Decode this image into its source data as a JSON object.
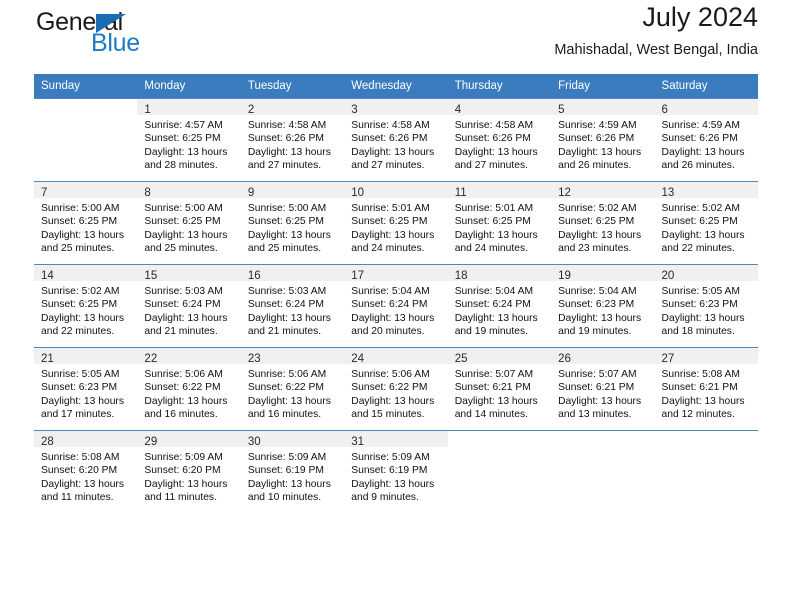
{
  "brand": {
    "name_top": "General",
    "name_bottom": "Blue",
    "triangle_color": "#1b6cb3",
    "blue_color": "#1f7ac4"
  },
  "header": {
    "title": "July 2024",
    "subtitle": "Mahishadal, West Bengal, India"
  },
  "theme": {
    "header_row_bg": "#3a7cbe",
    "header_row_text": "#ffffff",
    "daynum_bg": "#f0f0f0",
    "grid_line": "#4d88c4"
  },
  "weekday_headers": [
    "Sunday",
    "Monday",
    "Tuesday",
    "Wednesday",
    "Thursday",
    "Friday",
    "Saturday"
  ],
  "weeks": [
    [
      {
        "day": "",
        "lines": []
      },
      {
        "day": "1",
        "lines": [
          "Sunrise: 4:57 AM",
          "Sunset: 6:25 PM",
          "Daylight: 13 hours",
          "and 28 minutes."
        ]
      },
      {
        "day": "2",
        "lines": [
          "Sunrise: 4:58 AM",
          "Sunset: 6:26 PM",
          "Daylight: 13 hours",
          "and 27 minutes."
        ]
      },
      {
        "day": "3",
        "lines": [
          "Sunrise: 4:58 AM",
          "Sunset: 6:26 PM",
          "Daylight: 13 hours",
          "and 27 minutes."
        ]
      },
      {
        "day": "4",
        "lines": [
          "Sunrise: 4:58 AM",
          "Sunset: 6:26 PM",
          "Daylight: 13 hours",
          "and 27 minutes."
        ]
      },
      {
        "day": "5",
        "lines": [
          "Sunrise: 4:59 AM",
          "Sunset: 6:26 PM",
          "Daylight: 13 hours",
          "and 26 minutes."
        ]
      },
      {
        "day": "6",
        "lines": [
          "Sunrise: 4:59 AM",
          "Sunset: 6:26 PM",
          "Daylight: 13 hours",
          "and 26 minutes."
        ]
      }
    ],
    [
      {
        "day": "7",
        "lines": [
          "Sunrise: 5:00 AM",
          "Sunset: 6:25 PM",
          "Daylight: 13 hours",
          "and 25 minutes."
        ]
      },
      {
        "day": "8",
        "lines": [
          "Sunrise: 5:00 AM",
          "Sunset: 6:25 PM",
          "Daylight: 13 hours",
          "and 25 minutes."
        ]
      },
      {
        "day": "9",
        "lines": [
          "Sunrise: 5:00 AM",
          "Sunset: 6:25 PM",
          "Daylight: 13 hours",
          "and 25 minutes."
        ]
      },
      {
        "day": "10",
        "lines": [
          "Sunrise: 5:01 AM",
          "Sunset: 6:25 PM",
          "Daylight: 13 hours",
          "and 24 minutes."
        ]
      },
      {
        "day": "11",
        "lines": [
          "Sunrise: 5:01 AM",
          "Sunset: 6:25 PM",
          "Daylight: 13 hours",
          "and 24 minutes."
        ]
      },
      {
        "day": "12",
        "lines": [
          "Sunrise: 5:02 AM",
          "Sunset: 6:25 PM",
          "Daylight: 13 hours",
          "and 23 minutes."
        ]
      },
      {
        "day": "13",
        "lines": [
          "Sunrise: 5:02 AM",
          "Sunset: 6:25 PM",
          "Daylight: 13 hours",
          "and 22 minutes."
        ]
      }
    ],
    [
      {
        "day": "14",
        "lines": [
          "Sunrise: 5:02 AM",
          "Sunset: 6:25 PM",
          "Daylight: 13 hours",
          "and 22 minutes."
        ]
      },
      {
        "day": "15",
        "lines": [
          "Sunrise: 5:03 AM",
          "Sunset: 6:24 PM",
          "Daylight: 13 hours",
          "and 21 minutes."
        ]
      },
      {
        "day": "16",
        "lines": [
          "Sunrise: 5:03 AM",
          "Sunset: 6:24 PM",
          "Daylight: 13 hours",
          "and 21 minutes."
        ]
      },
      {
        "day": "17",
        "lines": [
          "Sunrise: 5:04 AM",
          "Sunset: 6:24 PM",
          "Daylight: 13 hours",
          "and 20 minutes."
        ]
      },
      {
        "day": "18",
        "lines": [
          "Sunrise: 5:04 AM",
          "Sunset: 6:24 PM",
          "Daylight: 13 hours",
          "and 19 minutes."
        ]
      },
      {
        "day": "19",
        "lines": [
          "Sunrise: 5:04 AM",
          "Sunset: 6:23 PM",
          "Daylight: 13 hours",
          "and 19 minutes."
        ]
      },
      {
        "day": "20",
        "lines": [
          "Sunrise: 5:05 AM",
          "Sunset: 6:23 PM",
          "Daylight: 13 hours",
          "and 18 minutes."
        ]
      }
    ],
    [
      {
        "day": "21",
        "lines": [
          "Sunrise: 5:05 AM",
          "Sunset: 6:23 PM",
          "Daylight: 13 hours",
          "and 17 minutes."
        ]
      },
      {
        "day": "22",
        "lines": [
          "Sunrise: 5:06 AM",
          "Sunset: 6:22 PM",
          "Daylight: 13 hours",
          "and 16 minutes."
        ]
      },
      {
        "day": "23",
        "lines": [
          "Sunrise: 5:06 AM",
          "Sunset: 6:22 PM",
          "Daylight: 13 hours",
          "and 16 minutes."
        ]
      },
      {
        "day": "24",
        "lines": [
          "Sunrise: 5:06 AM",
          "Sunset: 6:22 PM",
          "Daylight: 13 hours",
          "and 15 minutes."
        ]
      },
      {
        "day": "25",
        "lines": [
          "Sunrise: 5:07 AM",
          "Sunset: 6:21 PM",
          "Daylight: 13 hours",
          "and 14 minutes."
        ]
      },
      {
        "day": "26",
        "lines": [
          "Sunrise: 5:07 AM",
          "Sunset: 6:21 PM",
          "Daylight: 13 hours",
          "and 13 minutes."
        ]
      },
      {
        "day": "27",
        "lines": [
          "Sunrise: 5:08 AM",
          "Sunset: 6:21 PM",
          "Daylight: 13 hours",
          "and 12 minutes."
        ]
      }
    ],
    [
      {
        "day": "28",
        "lines": [
          "Sunrise: 5:08 AM",
          "Sunset: 6:20 PM",
          "Daylight: 13 hours",
          "and 11 minutes."
        ]
      },
      {
        "day": "29",
        "lines": [
          "Sunrise: 5:09 AM",
          "Sunset: 6:20 PM",
          "Daylight: 13 hours",
          "and 11 minutes."
        ]
      },
      {
        "day": "30",
        "lines": [
          "Sunrise: 5:09 AM",
          "Sunset: 6:19 PM",
          "Daylight: 13 hours",
          "and 10 minutes."
        ]
      },
      {
        "day": "31",
        "lines": [
          "Sunrise: 5:09 AM",
          "Sunset: 6:19 PM",
          "Daylight: 13 hours",
          "and 9 minutes."
        ]
      },
      {
        "day": "",
        "lines": []
      },
      {
        "day": "",
        "lines": []
      },
      {
        "day": "",
        "lines": []
      }
    ]
  ]
}
